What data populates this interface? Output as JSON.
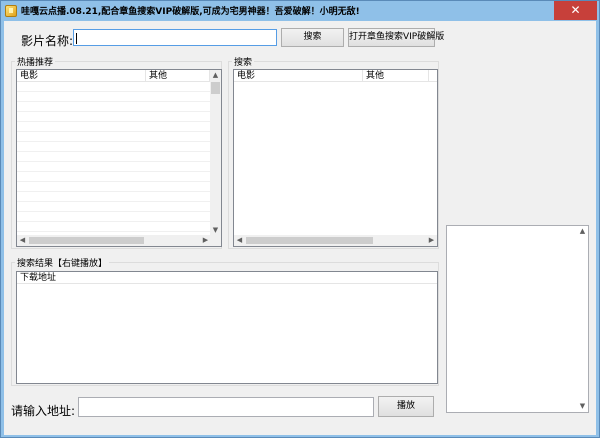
{
  "window": {
    "title": "哇嘎云点播.08.21,配合章鱼搜索VIP破解版,可成为宅男神器！吾爱破解！小明无敌!",
    "close_glyph": "✕"
  },
  "top_bar": {
    "movie_name_label": "影片名称:",
    "movie_name_value": "",
    "search_button": "搜索",
    "open_octopus_button": "打开章鱼搜索VIP破解版"
  },
  "hot_panel": {
    "title": "热播推荐",
    "columns": [
      "电影",
      "其他"
    ]
  },
  "search_panel": {
    "title": "搜索",
    "columns": [
      "电影",
      "其他"
    ]
  },
  "results_panel": {
    "title": "搜索结果【右键播放】",
    "columns": [
      "下载地址"
    ]
  },
  "bottom_bar": {
    "address_label": "请输入地址:",
    "address_value": "",
    "play_button": "播放"
  },
  "scroll_glyphs": {
    "up": "▲",
    "down": "▼",
    "left": "◀",
    "right": "▶"
  }
}
